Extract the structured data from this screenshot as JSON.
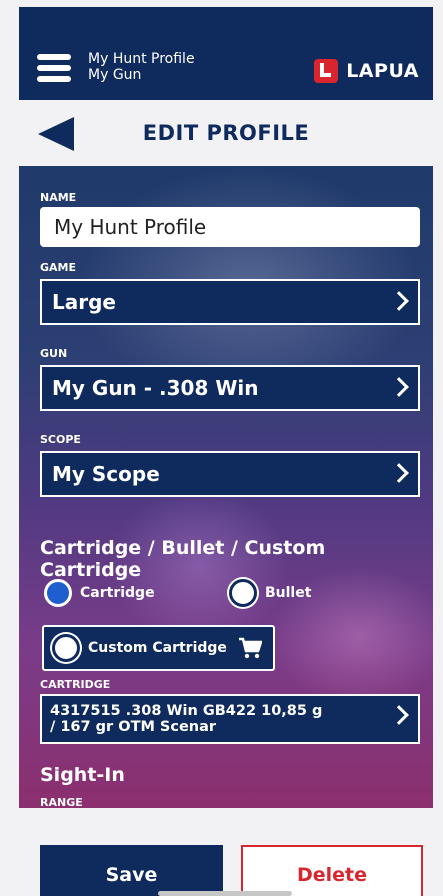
{
  "header": {
    "profile_name": "My Hunt Profile",
    "gun_name": "My Gun",
    "brand": "LAPUA"
  },
  "subheader": {
    "title": "EDIT PROFILE"
  },
  "form": {
    "name_label": "NAME",
    "name_value": "My Hunt Profile",
    "game_label": "GAME",
    "game_value": "Large",
    "gun_label": "GUN",
    "gun_value": "My Gun - .308 Win",
    "scope_label": "SCOPE",
    "scope_value": "My Scope",
    "ammo_section_title": "Cartridge / Bullet / Custom Cartridge",
    "ammo_options": [
      {
        "label": "Cartridge",
        "selected": true
      },
      {
        "label": "Bullet",
        "selected": false
      },
      {
        "label": "Custom Cartridge",
        "selected": false
      }
    ],
    "cartridge_label": "CARTRIDGE",
    "cartridge_value_line1": "4317515 .308 Win GB422 10,85 g",
    "cartridge_value_line2": "/ 167 gr OTM Scenar",
    "sight_in_title": "Sight-In",
    "range_label": "RANGE"
  },
  "actions": {
    "save_label": "Save",
    "delete_label": "Delete"
  },
  "colors": {
    "primary": "#0f2a5c",
    "accent_red": "#d9262e",
    "radio_selected": "#1f5ecf"
  },
  "icons": {
    "menu": "hamburger-menu-icon",
    "back": "back-arrow-icon",
    "chevron": "chevron-right-icon",
    "cart": "shopping-cart-icon",
    "brand_logo": "lapua-logo-icon"
  }
}
